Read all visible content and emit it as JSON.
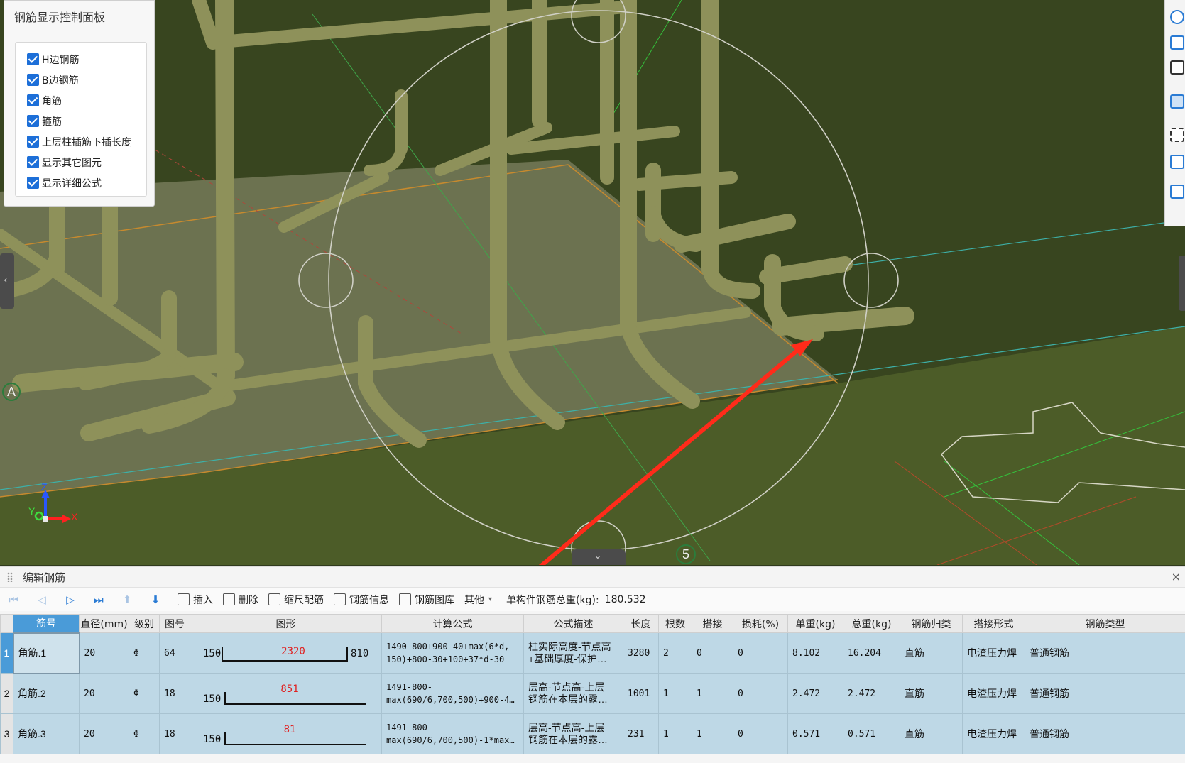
{
  "control_panel": {
    "title": "钢筋显示控制面板",
    "options": [
      {
        "label": "H边钢筋",
        "checked": true
      },
      {
        "label": "B边钢筋",
        "checked": true
      },
      {
        "label": "角筋",
        "checked": true
      },
      {
        "label": "箍筋",
        "checked": true
      },
      {
        "label": "上层柱插筋下插长度",
        "checked": true
      },
      {
        "label": "显示其它图元",
        "checked": true
      },
      {
        "label": "显示详细公式",
        "checked": true
      }
    ]
  },
  "viewport": {
    "axis_label_a_left": "A",
    "axis_label_a_right": "A",
    "axis_label_5": "5",
    "axes": {
      "x": "X",
      "y": "Y",
      "z": "Z"
    }
  },
  "editor": {
    "title": "编辑钢筋",
    "close": "×",
    "toolbar": {
      "insert": "插入",
      "delete": "删除",
      "scale_rebar": "缩尺配筋",
      "rebar_info": "钢筋信息",
      "rebar_library": "钢筋图库",
      "other": "其他",
      "total_weight_label": "单构件钢筋总重(kg):",
      "total_weight_value": "180.532"
    },
    "columns": [
      "筋号",
      "直径(mm)",
      "级别",
      "图号",
      "图形",
      "计算公式",
      "公式描述",
      "长度",
      "根数",
      "搭接",
      "损耗(%)",
      "单重(kg)",
      "总重(kg)",
      "钢筋归类",
      "搭接形式",
      "钢筋类型"
    ],
    "rows": [
      {
        "num": "1",
        "name": "角筋.1",
        "dia": "20",
        "grade": "Φ",
        "fig": "64",
        "shape": {
          "left": "150",
          "mid": "2320",
          "right": "810"
        },
        "formula": [
          "1490-800+900-40+max(6*d,",
          "150)+800-30+100+37*d-30"
        ],
        "desc": [
          "柱实际高度-节点高",
          "+基础厚度-保护…"
        ],
        "length": "3280",
        "count": "2",
        "lap": "0",
        "loss": "0",
        "unit_w": "8.102",
        "total_w": "16.204",
        "category": "直筋",
        "lap_type": "电渣压力焊",
        "rebar_type": "普通钢筋"
      },
      {
        "num": "2",
        "name": "角筋.2",
        "dia": "20",
        "grade": "Φ",
        "fig": "18",
        "shape": {
          "left": "150",
          "mid": "851",
          "right": ""
        },
        "formula": [
          "1491-800-",
          "max(690/6,700,500)+900-4…"
        ],
        "desc": [
          "层高-节点高-上层",
          "钢筋在本层的露…"
        ],
        "length": "1001",
        "count": "1",
        "lap": "1",
        "loss": "0",
        "unit_w": "2.472",
        "total_w": "2.472",
        "category": "直筋",
        "lap_type": "电渣压力焊",
        "rebar_type": "普通钢筋"
      },
      {
        "num": "3",
        "name": "角筋.3",
        "dia": "20",
        "grade": "Φ",
        "fig": "18",
        "shape": {
          "left": "150",
          "mid": "81",
          "right": ""
        },
        "formula": [
          "1491-800-",
          "max(690/6,700,500)-1*max…"
        ],
        "desc": [
          "层高-节点高-上层",
          "钢筋在本层的露…"
        ],
        "length": "231",
        "count": "1",
        "lap": "1",
        "loss": "0",
        "unit_w": "0.571",
        "total_w": "0.571",
        "category": "直筋",
        "lap_type": "电渣压力焊",
        "rebar_type": "普通钢筋"
      }
    ]
  }
}
